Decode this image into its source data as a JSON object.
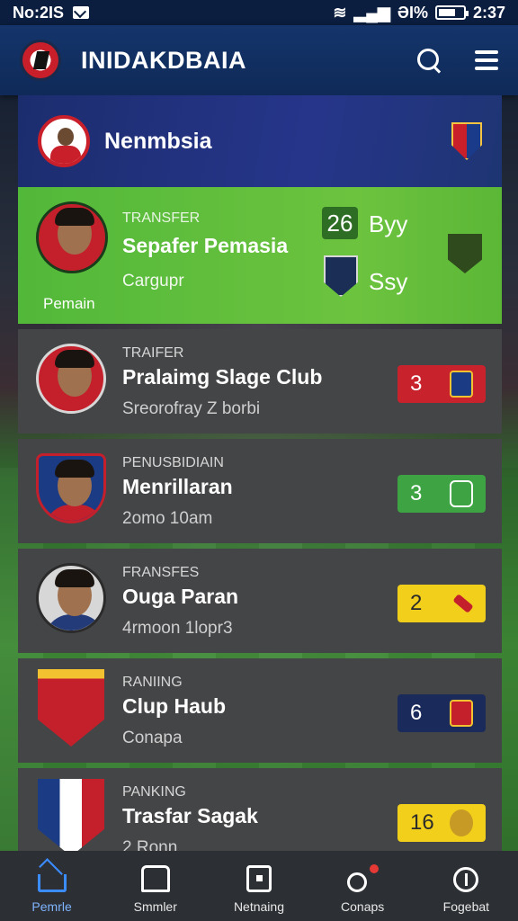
{
  "status_bar": {
    "carrier": "No:2IS",
    "battery": "ƏI%",
    "time": "2:37"
  },
  "app_bar": {
    "title": "INIDAKDBAIA"
  },
  "header": {
    "title": "Nenmbsia"
  },
  "feature": {
    "kicker": "TRANSFER",
    "title": "Sepafer Pemasia",
    "subtitle": "Cargupr",
    "photo_caption": "Pemain",
    "score_value": "26",
    "score_label": "Byy",
    "second_label": "Ssy"
  },
  "rows": [
    {
      "kicker": "TRAIFER",
      "title": "Pralaimg Slage Club",
      "subtitle": "Sreorofray Z borbi",
      "badge": "3",
      "badge_color": "#c8222d"
    },
    {
      "kicker": "PENUSBIDIAIN",
      "title": "Menrillaran",
      "subtitle": "2omo 10am",
      "badge": "3",
      "badge_color": "#3ea342"
    },
    {
      "kicker": "FRANSFES",
      "title": "Ouga Paran",
      "subtitle": "4rmoon 1lopr3",
      "badge": "2",
      "badge_color": "#f2cf1b"
    },
    {
      "kicker": "RANIING",
      "title": "Clup Haub",
      "subtitle": "Conapa",
      "badge": "6",
      "badge_color": "#1a2a5a"
    },
    {
      "kicker": "PANKING",
      "title": "Trasfar Sagak",
      "subtitle": "2 Ronn",
      "badge": "16",
      "badge_color": "#f2cf1b"
    }
  ],
  "bottom_nav": [
    {
      "label": "Pemrle",
      "icon": "home-icon",
      "active": true
    },
    {
      "label": "Smmler",
      "icon": "shirt-icon",
      "active": false
    },
    {
      "label": "Netnaing",
      "icon": "card-icon",
      "active": false
    },
    {
      "label": "Conaps",
      "icon": "whistle-icon",
      "active": false
    },
    {
      "label": "Fogebat",
      "icon": "compass-icon",
      "active": false
    }
  ]
}
